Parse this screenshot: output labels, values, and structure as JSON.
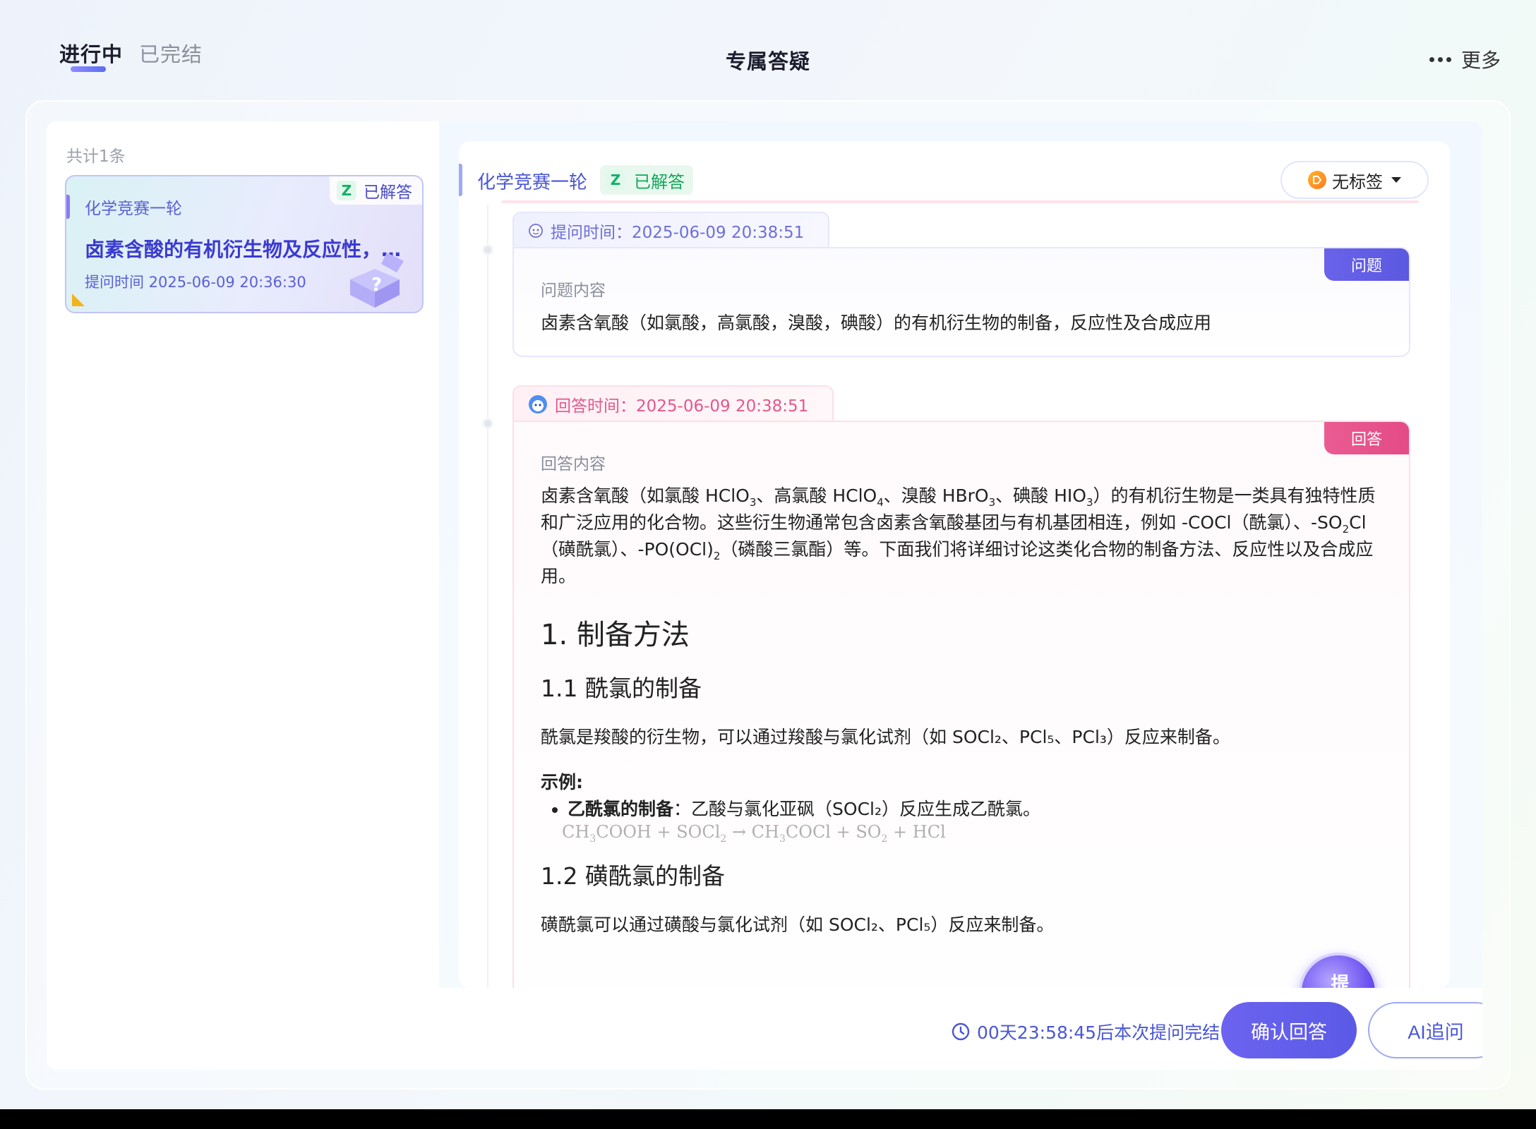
{
  "header": {
    "tabs": [
      {
        "label": "进行中",
        "active": true
      },
      {
        "label": "已完结",
        "active": false
      }
    ],
    "title": "专属答疑",
    "more_label": "更多"
  },
  "list": {
    "count_label": "共计1条",
    "items": [
      {
        "subject": "化学竞赛一轮",
        "badge": "已解答",
        "title": "卤素含酸的有机衍生物及反应性，…",
        "time": "提问时间 2025-06-09 20:36:30"
      }
    ]
  },
  "detail": {
    "subject": "化学竞赛一轮",
    "status": "已解答",
    "tag_label": "无标签",
    "question": {
      "time_label": "提问时间：2025-06-09 20:38:51",
      "box_label": "问题",
      "title": "问题内容",
      "text": "卤素含氧酸（如氯酸，高氯酸，溴酸，碘酸）的有机衍生物的制备，反应性及合成应用"
    },
    "answer": {
      "time_label": "回答时间：2025-06-09 20:38:51",
      "box_label": "回答",
      "title": "回答内容",
      "h1": "1. 制备方法",
      "h2a": "1.1 酰氯的制备",
      "para2": "酰氯是羧酸的衍生物，可以通过羧酸与氯化试剂（如 SOCl₂、PCl₅、PCl₃）反应来制备。",
      "example_label": "示例:",
      "bullet_bold": "乙酰氯的制备",
      "bullet_text": "：乙酸与氯化亚砜（SOCl₂）反应生成乙酰氯。",
      "h2b": "1.2 磺酰氯的制备",
      "para3": "磺酰氯可以通过磺酸与氯化试剂（如 SOCl₂、PCl₅）反应来制备。"
    },
    "fab_label": "提问"
  },
  "footer": {
    "countdown": "00天23:58:45后本次提问完结",
    "confirm_label": "确认回答",
    "ai_label": "AI追问"
  }
}
